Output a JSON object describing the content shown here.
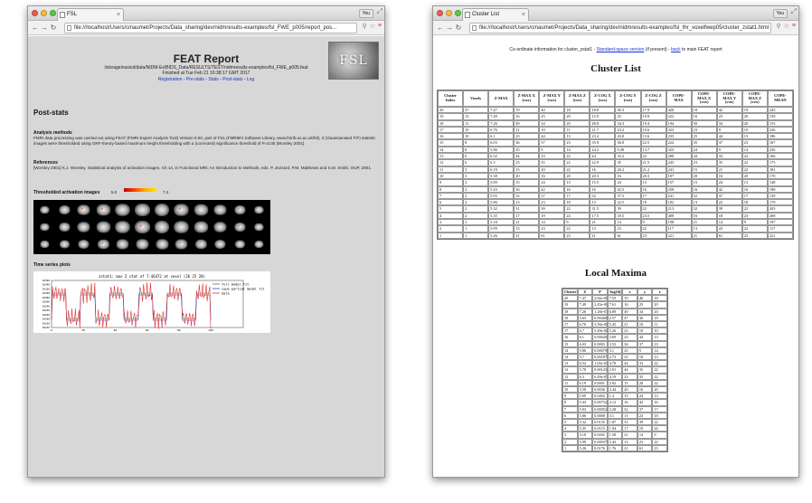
{
  "window1": {
    "tab_title": "FSL",
    "profile": "You",
    "url": "file:///localhost/Users/cmaumet/Projects/Data_sharing/dev/nidmresults-examples/fsl_FWE_p005/report_pos...",
    "page": {
      "title": "FEAT Report",
      "path": "/storage/essicd/data/NIDM-Ex/BIDS_Data/RESULTS/TEST/nidmresults-examples/fsl_FWE_p005.feat",
      "finished": "Finished at Tue Feb 21 16:38:17 GMT 2017",
      "nav_links": [
        "Registration",
        "Pre-stats",
        "Stats",
        "Post-stats",
        "Log"
      ],
      "nav_sep": "-",
      "logo_text": "FSL",
      "section_title": "Post-stats",
      "methods_heading": "Analysis methods",
      "methods_text": "FMRI data processing was carried out using FEAT (FMRI Expert Analysis Tool) Version 6.00, part of FSL (FMRIB's Software Library, www.fmrib.ox.ac.uk/fsl). Z (Gaussianised T/F) statistic images were thresholded using GRF-theory-based maximum height thresholding with a (corrected) significance threshold of P=0.05 [Worsley 2001].",
      "references_heading": "References",
      "references_text": "[Worsley 2001] K.J. Worsley. Statistical analysis of activation images. Ch 14, in Functional MRI: An Introduction to Methods, eds. P. Jezzard, P.M. Matthews and S.M. Smith. OUP, 2001.",
      "thresh_heading": "Thresholded activation images",
      "thresh_min": "5.0",
      "thresh_max": "7.4",
      "zstat_label": "zstat1",
      "zstat_sep": "-",
      "zstat_contrast": "C1 (tone counting vs baseline)",
      "ts_heading": "Time series plots",
      "plot_title": "zstat1: max Z stat of 7.46472 at voxel (26 25 20)",
      "plot_legend": [
        "full model fit",
        "cope partial model fit",
        "data"
      ],
      "plot_colors": [
        "#2e8b57",
        "#2b4fd1",
        "#e03030"
      ],
      "plot_y_ticks": [
        "10360",
        "10340",
        "10320",
        "10300",
        "10280",
        "10260",
        "10240",
        "10220",
        "10200",
        "10180",
        "10160",
        "10140"
      ],
      "plot_x_ticks": [
        "0",
        "20",
        "40",
        "60",
        "80",
        "100"
      ]
    }
  },
  "window2": {
    "tab_title": "Cluster List",
    "profile": "You",
    "url": "file:///localhost/Users/cmaumet/Projects/Data_sharing/dev/nidmresults-examples/fsl_thr_voxelfwep05/cluster_zstat1.html",
    "page": {
      "info_prefix": "Co-ordinate information for cluster_zstat1 - ",
      "info_link1": "Standard-space version",
      "info_mid": " (if present) - ",
      "info_link2": "back",
      "info_suffix": " to main FEAT report",
      "cluster_title": "Cluster List",
      "cluster_headers": [
        "Cluster Index",
        "Voxels",
        "Z-MAX",
        "Z-MAX X (vox)",
        "Z-MAX Y (vox)",
        "Z-MAX Z (vox)",
        "Z-COG X (vox)",
        "Z-COG Y (vox)",
        "Z-COG Z (vox)",
        "COPE-MAX",
        "COPE-MAX X (vox)",
        "COPE-MAX Y (vox)",
        "COPE-MAX Z (vox)",
        "COPE-MEAN"
      ],
      "cluster_rows": [
        [
          "20",
          "27",
          "7.47",
          "19",
          "40",
          "18",
          "18.8",
          "40.3",
          "17.9",
          "420",
          "18",
          "42",
          "19",
          "243"
        ],
        [
          "19",
          "13",
          "7.49",
          "16",
          "25",
          "20",
          "15.9",
          "25",
          "19.9",
          "222",
          "16",
          "23",
          "20",
          "159"
        ],
        [
          "18",
          "11",
          "7.26",
          "49",
          "34",
          "20",
          "48.8",
          "34.3",
          "19.4",
          "194",
          "50",
          "34",
          "20",
          "153"
        ],
        [
          "17",
          "10",
          "6.76",
          "21",
          "10",
          "11",
          "21.7",
          "10.2",
          "10.6",
          "323",
          "23",
          "9",
          "10",
          "226"
        ],
        [
          "16",
          "10",
          "6.1",
          "23",
          "44",
          "13",
          "23.4",
          "43.8",
          "13.6",
          "235",
          "25",
          "44",
          "13",
          "186"
        ],
        [
          "15",
          "8",
          "6.03",
          "36",
          "37",
          "23",
          "35.9",
          "36.8",
          "22.5",
          "222",
          "35",
          "37",
          "23",
          "167"
        ],
        [
          "14",
          "8",
          "5.86",
          "25",
          "9",
          "14",
          "24.2",
          "9.49",
          "13.7",
          "323",
          "24",
          "9",
          "14",
          "236"
        ],
        [
          "13",
          "6",
          "6.52",
          "44",
          "33",
          "22",
          "44",
          "33.2",
          "22",
          "280",
          "44",
          "33",
          "22",
          "166"
        ],
        [
          "12",
          "6",
          "6.3",
          "23",
          "35",
          "22",
          "22.9",
          "35",
          "21.5",
          "243",
          "23",
          "35",
          "22",
          "175"
        ],
        [
          "11",
          "5",
          "6.19",
          "15",
          "20",
          "22",
          "16",
          "20.2",
          "21.2",
          "241",
          "15",
          "21",
          "22",
          "181"
        ],
        [
          "10",
          "3",
          "5.58",
          "20",
          "16",
          "20",
          "20.3",
          "16",
          "20.3",
          "187",
          "20",
          "16",
          "20",
          "170"
        ],
        [
          "9",
          "2",
          "5.09",
          "15",
          "24",
          "13",
          "15.5",
          "24",
          "13",
          "157",
          "15",
          "24",
          "13",
          "148"
        ],
        [
          "8",
          "2",
          "5.43",
          "16",
          "42",
          "16",
          "16",
          "42.5",
          "16",
          "258",
          "16",
          "42",
          "16",
          "198"
        ],
        [
          "7",
          "2",
          "5.93",
          "52",
          "37",
          "17",
          "52",
          "37.5",
          "17",
          "241",
          "52",
          "37",
          "17",
          "139"
        ],
        [
          "6",
          "2",
          "5.86",
          "13",
          "23",
          "18",
          "13",
          "22.5",
          "18",
          "182",
          "13",
          "22",
          "18",
          "170"
        ],
        [
          "5",
          "2",
          "5.32",
          "31",
          "39",
          "22",
          "31.5",
          "39",
          "22",
          "213",
          "32",
          "39",
          "22",
          "203"
        ],
        [
          "4",
          "2",
          "5.35",
          "17",
          "19",
          "24",
          "17.5",
          "18.5",
          "23.5",
          "409",
          "16",
          "18",
          "23",
          "268"
        ],
        [
          "3",
          "1",
          "5.18",
          "21",
          "14",
          "9",
          "21",
          "14",
          "9",
          "198",
          "21",
          "14",
          "9",
          "197"
        ],
        [
          "2",
          "1",
          "5.99",
          "13",
          "23",
          "22",
          "13",
          "23",
          "22",
          "117",
          "13",
          "23",
          "22",
          "117"
        ],
        [
          "1",
          "1",
          "5.26",
          "21",
          "61",
          "23",
          "21",
          "61",
          "23",
          "221",
          "21",
          "61",
          "23",
          "221"
        ]
      ],
      "lm_title": "Local Maxima",
      "lm_headers": [
        "Cluster Index",
        "Z",
        "P",
        "-log10(P)",
        "x",
        "y",
        "z"
      ],
      "lm_rows": [
        [
          "20",
          "7.47",
          "2.82e-08",
          "7.55",
          "19",
          "40",
          "18"
        ],
        [
          "19",
          "7.49",
          "2.45e-08",
          "7.61",
          "16",
          "25",
          "20"
        ],
        [
          "18",
          "7.26",
          "1.28e-07",
          "6.89",
          "49",
          "34",
          "20"
        ],
        [
          "18",
          "5.63",
          "0.00268",
          "2.57",
          "47",
          "36",
          "18"
        ],
        [
          "17",
          "6.76",
          "3.56e-06",
          "5.45",
          "21",
          "10",
          "11"
        ],
        [
          "17",
          "6.7",
          "5.49e-06",
          "5.26",
          "23",
          "10",
          "10"
        ],
        [
          "16",
          "6.1",
          "0.000204",
          "3.69",
          "23",
          "44",
          "13"
        ],
        [
          "15",
          "6.03",
          "0.0003",
          "3.52",
          "36",
          "37",
          "23"
        ],
        [
          "14",
          "5.86",
          "0.000795",
          "3.1",
          "25",
          "9",
          "14"
        ],
        [
          "14",
          "5.7",
          "0.00187",
          "2.73",
          "23",
          "10",
          "13"
        ],
        [
          "13",
          "6.52",
          "1.65e-05",
          "4.78",
          "44",
          "33",
          "22"
        ],
        [
          "13",
          "5.78",
          "0.00125",
          "2.91",
          "44",
          "35",
          "22"
        ],
        [
          "12",
          "6.3",
          "6.49e-05",
          "4.19",
          "23",
          "35",
          "22"
        ],
        [
          "11",
          "6.19",
          "0.0001",
          "3.92",
          "15",
          "20",
          "22"
        ],
        [
          "10",
          "5.58",
          "0.0036",
          "2.44",
          "20",
          "16",
          "20"
        ],
        [
          "9",
          "5.09",
          "0.0402",
          "1.4",
          "15",
          "24",
          "13"
        ],
        [
          "8",
          "5.43",
          "0.00752",
          "2.12",
          "16",
          "42",
          "16"
        ],
        [
          "7",
          "5.93",
          "0.000529",
          "3.28",
          "52",
          "37",
          "17"
        ],
        [
          "6",
          "5.86",
          "0.0008",
          "3.1",
          "13",
          "23",
          "18"
        ],
        [
          "5",
          "5.32",
          "0.0135",
          "1.87",
          "31",
          "39",
          "22"
        ],
        [
          "4",
          "5.35",
          "0.0115",
          "1.94",
          "17",
          "19",
          "24"
        ],
        [
          "3",
          "5.18",
          "0.0265",
          "1.58",
          "21",
          "14",
          "9"
        ],
        [
          "2",
          "5.99",
          "0.000372",
          "3.43",
          "13",
          "23",
          "22"
        ],
        [
          "1",
          "5.26",
          "0.0176",
          "1.76",
          "21",
          "61",
          "23"
        ]
      ]
    }
  }
}
